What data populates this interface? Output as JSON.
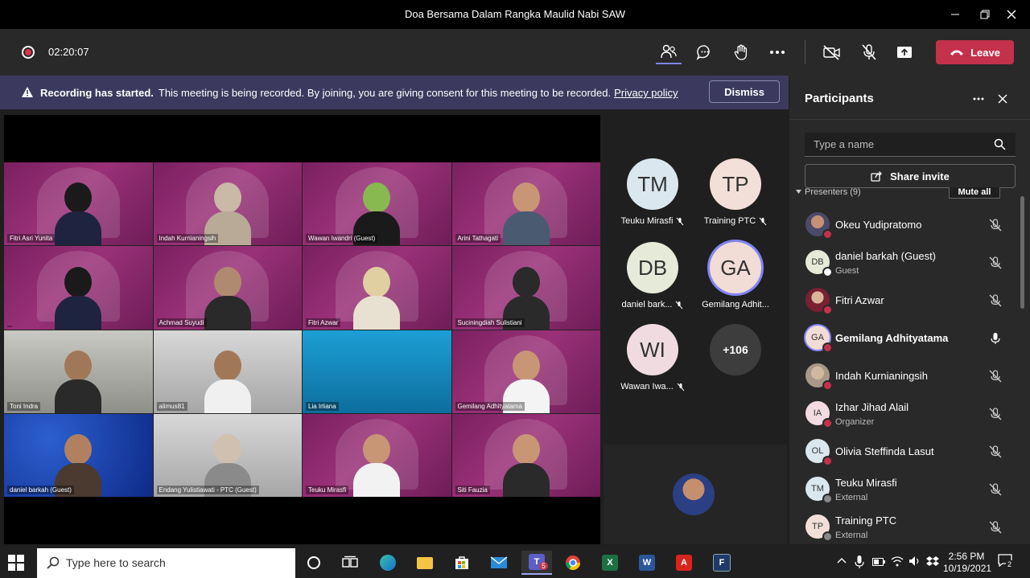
{
  "window": {
    "title": "Doa Bersama Dalam Rangka Maulid Nabi SAW"
  },
  "toolbar": {
    "timer": "02:20:07",
    "leave_label": "Leave"
  },
  "banner": {
    "bold": "Recording has started.",
    "message": "This meeting is being recorded. By joining, you are giving consent for this meeting to be recorded.",
    "link": "Privacy policy",
    "dismiss": "Dismiss"
  },
  "gallery": {
    "tiles": [
      {
        "name": "Fitri Asri Yunita"
      },
      {
        "name": "Indah Kurnianingsih"
      },
      {
        "name": "Wawan Iwandri (Guest)"
      },
      {
        "name": "Arini Tathagati"
      },
      {
        "name": ""
      },
      {
        "name": "Achmad Suyudi"
      },
      {
        "name": "Fitri Azwar"
      },
      {
        "name": "Suciningdiah Sulistiani"
      },
      {
        "name": "Toni Indra"
      },
      {
        "name": "alimus81"
      },
      {
        "name": "Lia Irliana"
      },
      {
        "name": "Gemilang Adhityatama"
      },
      {
        "name": "daniel barkah (Guest)"
      },
      {
        "name": "Endang Yulistiawati - PTC (Guest)"
      },
      {
        "name": "Teuku Mirasfi"
      },
      {
        "name": "Siti Fauzia"
      }
    ]
  },
  "roster": {
    "items": [
      {
        "initials": "TM",
        "label": "Teuku Mirasfi"
      },
      {
        "initials": "TP",
        "label": "Training PTC"
      },
      {
        "initials": "DB",
        "label": "daniel bark..."
      },
      {
        "initials": "GA",
        "label": "Gemilang Adhit..."
      },
      {
        "initials": "WI",
        "label": "Wawan Iwa..."
      }
    ],
    "more": "+106"
  },
  "participants": {
    "title": "Participants",
    "search_placeholder": "Type a name",
    "share_invite": "Share invite",
    "presenters_label": "Presenters (9)",
    "mute_all": "Mute all",
    "list": [
      {
        "name": "Okeu Yudipratomo",
        "role": "",
        "initials": ""
      },
      {
        "name": "daniel barkah (Guest)",
        "role": "Guest",
        "initials": "DB"
      },
      {
        "name": "Fitri Azwar",
        "role": "",
        "initials": ""
      },
      {
        "name": "Gemilang Adhityatama",
        "role": "",
        "initials": "GA"
      },
      {
        "name": "Indah Kurnianingsih",
        "role": "",
        "initials": ""
      },
      {
        "name": "Izhar Jihad Alail",
        "role": "Organizer",
        "initials": "IA"
      },
      {
        "name": "Olivia Steffinda Lasut",
        "role": "",
        "initials": "OL"
      },
      {
        "name": "Teuku Mirasfi",
        "role": "External",
        "initials": "TM"
      },
      {
        "name": "Training PTC",
        "role": "External",
        "initials": "TP"
      }
    ]
  },
  "taskbar": {
    "search_placeholder": "Type here to search",
    "teams_badge": "5",
    "time": "2:56 PM",
    "date": "10/19/2021",
    "notifications": "2"
  }
}
